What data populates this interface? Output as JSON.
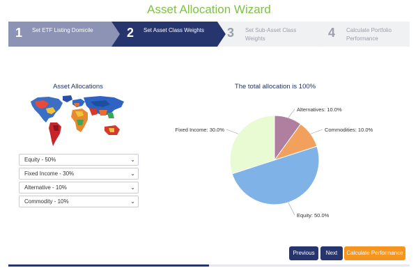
{
  "page": {
    "title": "Asset Allocation Wizard"
  },
  "steps": [
    {
      "number": "1",
      "label": "Set ETF Listing Domicile",
      "state": "done"
    },
    {
      "number": "2",
      "label": "Set Asset Class Weights",
      "state": "active"
    },
    {
      "number": "3",
      "label": "Set Sub-Asset Class Weights",
      "state": "upcoming"
    },
    {
      "number": "4",
      "label": "Calculate Portfolio Performance",
      "state": "upcoming"
    }
  ],
  "left_panel": {
    "title": "Asset Allocations",
    "selects": [
      {
        "value": "Equity - 50%"
      },
      {
        "value": "Fixed Income - 30%"
      },
      {
        "value": "Alternative - 10%"
      },
      {
        "value": "Commodity - 10%"
      }
    ]
  },
  "chart_data": {
    "type": "pie",
    "title": "The total allocation is 100%",
    "slices": [
      {
        "label": "Equity: 50.0%",
        "value": 50.0,
        "color": "#7fb3e8"
      },
      {
        "label": "Fixed Income: 30.0%",
        "value": 30.0,
        "color": "#e9fbd2"
      },
      {
        "label": "Alternatives: 10.0%",
        "value": 10.0,
        "color": "#b07e9e"
      },
      {
        "label": "Commodities: 10.0%",
        "value": 10.0,
        "color": "#f2a05e"
      }
    ]
  },
  "buttons": {
    "previous": "Previous",
    "next": "Next",
    "calculate": "Calculate Performance"
  },
  "colors": {
    "brand_navy": "#27356e",
    "brand_green": "#7dc242",
    "accent_orange": "#f7941d"
  },
  "progress": {
    "fraction": 0.5
  }
}
